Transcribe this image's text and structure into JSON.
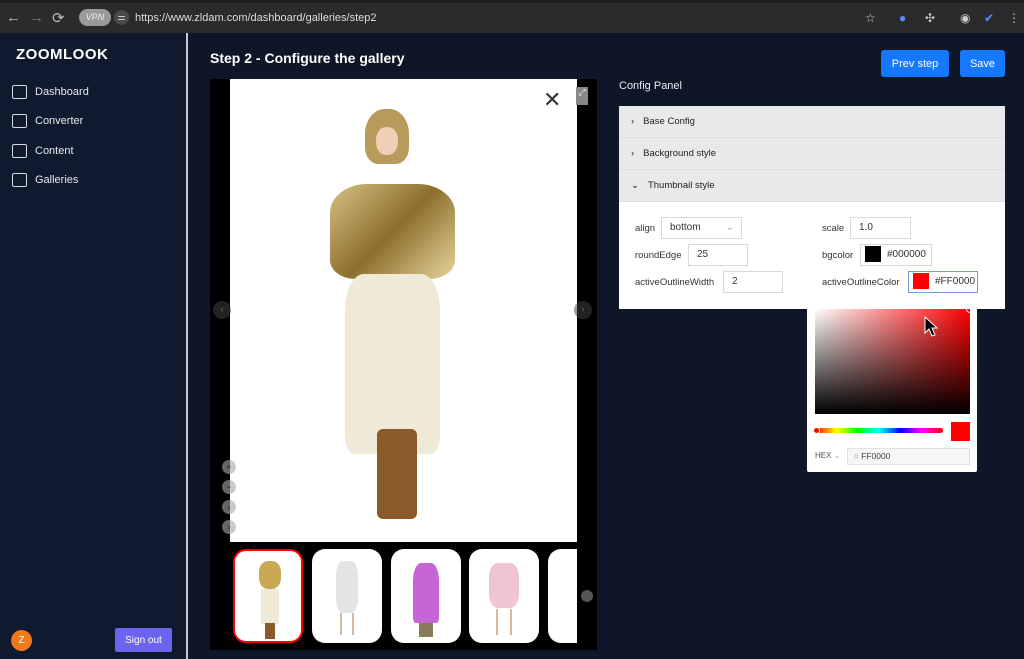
{
  "browser": {
    "url": "https://www.zldam.com/dashboard/galleries/step2",
    "vpn_label": "VPN"
  },
  "sidebar": {
    "logo": "ZOOMLOOK",
    "items": [
      {
        "label": "Dashboard",
        "icon": "home-icon"
      },
      {
        "label": "Converter",
        "icon": "copy-icon"
      },
      {
        "label": "Content",
        "icon": "folder-icon"
      },
      {
        "label": "Galleries",
        "icon": "image-icon"
      }
    ],
    "avatar": "Z",
    "sign_out": "Sign out"
  },
  "header": {
    "title": "Step 2 - Configure the gallery",
    "prev_step": "Prev step",
    "save": "Save"
  },
  "config": {
    "title": "Config Panel",
    "sections": [
      {
        "label": "Base Config",
        "expanded": false
      },
      {
        "label": "Background style",
        "expanded": false
      },
      {
        "label": "Thumbnail style",
        "expanded": true
      }
    ],
    "fields": {
      "align": {
        "label": "align",
        "value": "bottom"
      },
      "scale": {
        "label": "scale",
        "value": "1.0"
      },
      "roundEdge": {
        "label": "roundEdge",
        "value": "25"
      },
      "bgcolor": {
        "label": "bgcolor",
        "value": "#000000"
      },
      "activeOutlineWidth": {
        "label": "activeOutlineWidth",
        "value": "2"
      },
      "activeOutlineColor": {
        "label": "activeOutlineColor",
        "value": "#FF0000"
      }
    }
  },
  "color_picker": {
    "mode": "HEX",
    "hex": "FF0000",
    "hash": "#"
  },
  "colors": {
    "accent": "#1677ff",
    "signout": "#6c63f0",
    "active_outline": "#FF0000"
  }
}
